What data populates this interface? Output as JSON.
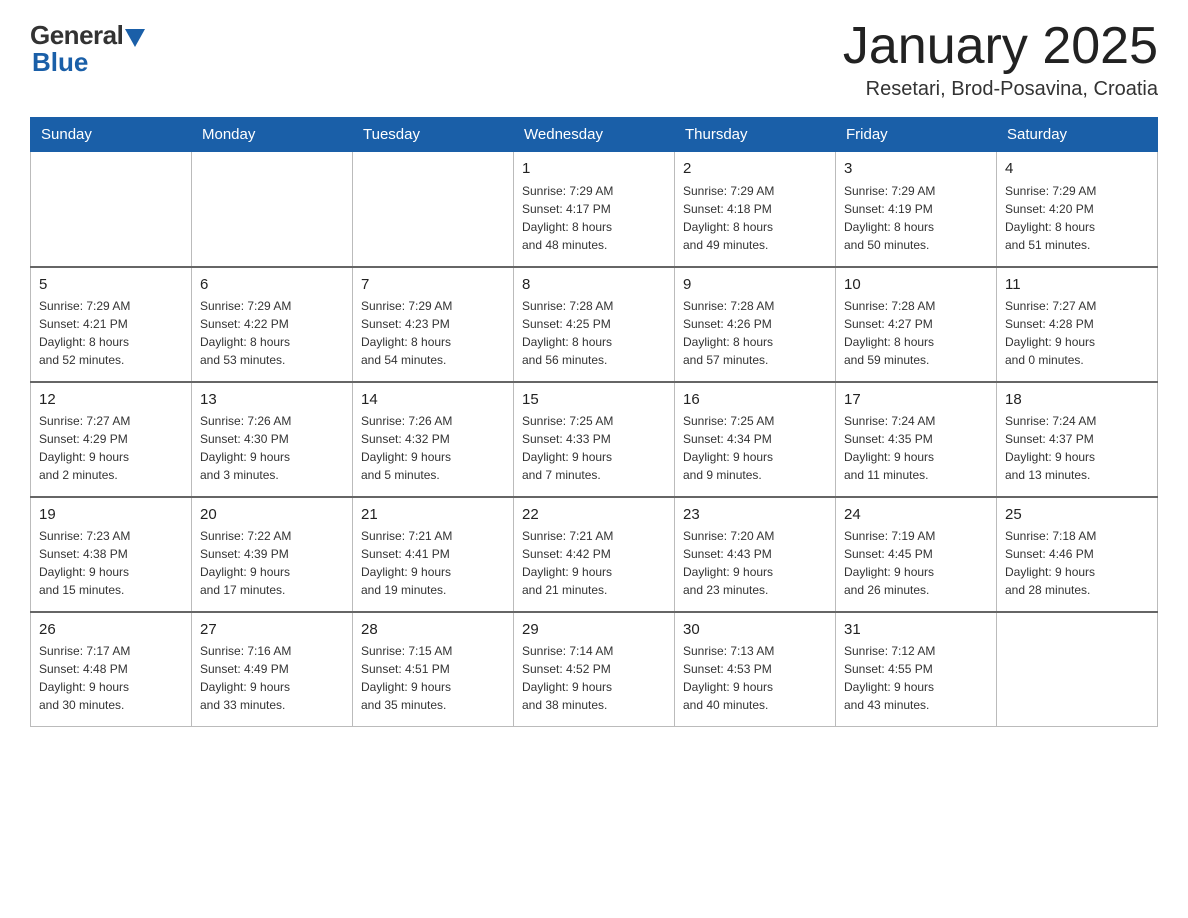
{
  "header": {
    "logo": {
      "general": "General",
      "blue": "Blue"
    },
    "title": "January 2025",
    "location": "Resetari, Brod-Posavina, Croatia"
  },
  "days_of_week": [
    "Sunday",
    "Monday",
    "Tuesday",
    "Wednesday",
    "Thursday",
    "Friday",
    "Saturday"
  ],
  "weeks": [
    [
      {
        "day": "",
        "info": ""
      },
      {
        "day": "",
        "info": ""
      },
      {
        "day": "",
        "info": ""
      },
      {
        "day": "1",
        "info": "Sunrise: 7:29 AM\nSunset: 4:17 PM\nDaylight: 8 hours\nand 48 minutes."
      },
      {
        "day": "2",
        "info": "Sunrise: 7:29 AM\nSunset: 4:18 PM\nDaylight: 8 hours\nand 49 minutes."
      },
      {
        "day": "3",
        "info": "Sunrise: 7:29 AM\nSunset: 4:19 PM\nDaylight: 8 hours\nand 50 minutes."
      },
      {
        "day": "4",
        "info": "Sunrise: 7:29 AM\nSunset: 4:20 PM\nDaylight: 8 hours\nand 51 minutes."
      }
    ],
    [
      {
        "day": "5",
        "info": "Sunrise: 7:29 AM\nSunset: 4:21 PM\nDaylight: 8 hours\nand 52 minutes."
      },
      {
        "day": "6",
        "info": "Sunrise: 7:29 AM\nSunset: 4:22 PM\nDaylight: 8 hours\nand 53 minutes."
      },
      {
        "day": "7",
        "info": "Sunrise: 7:29 AM\nSunset: 4:23 PM\nDaylight: 8 hours\nand 54 minutes."
      },
      {
        "day": "8",
        "info": "Sunrise: 7:28 AM\nSunset: 4:25 PM\nDaylight: 8 hours\nand 56 minutes."
      },
      {
        "day": "9",
        "info": "Sunrise: 7:28 AM\nSunset: 4:26 PM\nDaylight: 8 hours\nand 57 minutes."
      },
      {
        "day": "10",
        "info": "Sunrise: 7:28 AM\nSunset: 4:27 PM\nDaylight: 8 hours\nand 59 minutes."
      },
      {
        "day": "11",
        "info": "Sunrise: 7:27 AM\nSunset: 4:28 PM\nDaylight: 9 hours\nand 0 minutes."
      }
    ],
    [
      {
        "day": "12",
        "info": "Sunrise: 7:27 AM\nSunset: 4:29 PM\nDaylight: 9 hours\nand 2 minutes."
      },
      {
        "day": "13",
        "info": "Sunrise: 7:26 AM\nSunset: 4:30 PM\nDaylight: 9 hours\nand 3 minutes."
      },
      {
        "day": "14",
        "info": "Sunrise: 7:26 AM\nSunset: 4:32 PM\nDaylight: 9 hours\nand 5 minutes."
      },
      {
        "day": "15",
        "info": "Sunrise: 7:25 AM\nSunset: 4:33 PM\nDaylight: 9 hours\nand 7 minutes."
      },
      {
        "day": "16",
        "info": "Sunrise: 7:25 AM\nSunset: 4:34 PM\nDaylight: 9 hours\nand 9 minutes."
      },
      {
        "day": "17",
        "info": "Sunrise: 7:24 AM\nSunset: 4:35 PM\nDaylight: 9 hours\nand 11 minutes."
      },
      {
        "day": "18",
        "info": "Sunrise: 7:24 AM\nSunset: 4:37 PM\nDaylight: 9 hours\nand 13 minutes."
      }
    ],
    [
      {
        "day": "19",
        "info": "Sunrise: 7:23 AM\nSunset: 4:38 PM\nDaylight: 9 hours\nand 15 minutes."
      },
      {
        "day": "20",
        "info": "Sunrise: 7:22 AM\nSunset: 4:39 PM\nDaylight: 9 hours\nand 17 minutes."
      },
      {
        "day": "21",
        "info": "Sunrise: 7:21 AM\nSunset: 4:41 PM\nDaylight: 9 hours\nand 19 minutes."
      },
      {
        "day": "22",
        "info": "Sunrise: 7:21 AM\nSunset: 4:42 PM\nDaylight: 9 hours\nand 21 minutes."
      },
      {
        "day": "23",
        "info": "Sunrise: 7:20 AM\nSunset: 4:43 PM\nDaylight: 9 hours\nand 23 minutes."
      },
      {
        "day": "24",
        "info": "Sunrise: 7:19 AM\nSunset: 4:45 PM\nDaylight: 9 hours\nand 26 minutes."
      },
      {
        "day": "25",
        "info": "Sunrise: 7:18 AM\nSunset: 4:46 PM\nDaylight: 9 hours\nand 28 minutes."
      }
    ],
    [
      {
        "day": "26",
        "info": "Sunrise: 7:17 AM\nSunset: 4:48 PM\nDaylight: 9 hours\nand 30 minutes."
      },
      {
        "day": "27",
        "info": "Sunrise: 7:16 AM\nSunset: 4:49 PM\nDaylight: 9 hours\nand 33 minutes."
      },
      {
        "day": "28",
        "info": "Sunrise: 7:15 AM\nSunset: 4:51 PM\nDaylight: 9 hours\nand 35 minutes."
      },
      {
        "day": "29",
        "info": "Sunrise: 7:14 AM\nSunset: 4:52 PM\nDaylight: 9 hours\nand 38 minutes."
      },
      {
        "day": "30",
        "info": "Sunrise: 7:13 AM\nSunset: 4:53 PM\nDaylight: 9 hours\nand 40 minutes."
      },
      {
        "day": "31",
        "info": "Sunrise: 7:12 AM\nSunset: 4:55 PM\nDaylight: 9 hours\nand 43 minutes."
      },
      {
        "day": "",
        "info": ""
      }
    ]
  ]
}
